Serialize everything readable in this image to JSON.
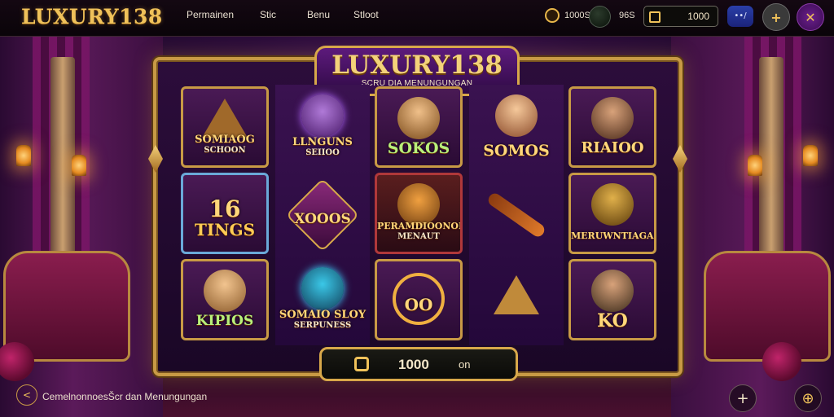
{
  "header": {
    "logo": "LUXURY138",
    "nav": [
      "Permainen",
      "Stic",
      "Benu",
      "Stloot"
    ],
    "coin_value": "1000S",
    "orb_value": "96S",
    "balance": "1000",
    "pill_label": "••/",
    "plus_symbol": "+",
    "x_symbol": "✕"
  },
  "machine": {
    "title": "LUXURY138",
    "subtitle": "SCRU DIA MENUNGUNGAN"
  },
  "reels": [
    [
      {
        "label": "SOMIAOG",
        "sub": "SCHOON"
      },
      {
        "label": "16",
        "sub": "TINGS"
      },
      {
        "label": "KIPIOS",
        "sub": ""
      }
    ],
    [
      {
        "label": "LLNGUNS",
        "sub": "SEIIOO"
      },
      {
        "label": "XOOOS",
        "sub": ""
      },
      {
        "label": "SOMAIO SLOY",
        "sub": "SERPUNESS"
      }
    ],
    [
      {
        "label": "SOKOS",
        "sub": ""
      },
      {
        "label": "PERAMDIOONOIO",
        "sub": "MENAUT"
      },
      {
        "label": "OO",
        "sub": ""
      }
    ],
    [
      {
        "label": "SOMOS",
        "sub": ""
      },
      {
        "label": "",
        "sub": ""
      },
      {
        "label": "",
        "sub": ""
      }
    ],
    [
      {
        "label": "RIAIOO",
        "sub": ""
      },
      {
        "label": "MERUWNTIAGAN",
        "sub": ""
      },
      {
        "label": "KO",
        "sub": ""
      }
    ]
  ],
  "bet": {
    "value": "1000",
    "unit": "on"
  },
  "footer": {
    "text": "CemelnonnoesŠcr dan Menungungan",
    "left_icon": "share-icon",
    "plus_icon": "+",
    "settings_icon": "⊕"
  }
}
